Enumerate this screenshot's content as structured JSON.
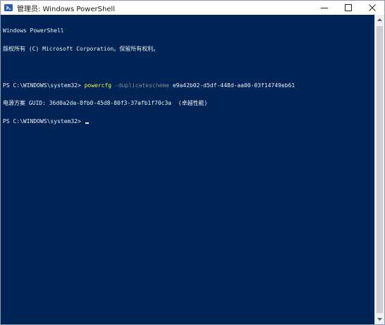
{
  "window": {
    "title": "管理员: Windows PowerShell",
    "icon": "powershell-icon",
    "controls": {
      "minimize": "minimize-icon",
      "maximize": "maximize-icon",
      "close": "close-icon"
    }
  },
  "console": {
    "banner_1": "Windows PowerShell",
    "banner_2": "版权所有 (C) Microsoft Corporation。保留所有权利。",
    "prompt_1": "PS C:\\WINDOWS\\system32> ",
    "command_name": "powercfg",
    "command_param": " -duplicatescheme",
    "command_arg": " e9a42b02-d5df-448d-aa00-03f14749eb61",
    "output_line": "电源方案 GUID: 36d0a2da-8fb0-45d8-80f3-37afb1f70c3a  (卓越性能)",
    "prompt_2": "PS C:\\WINDOWS\\system32> "
  },
  "colors": {
    "console_bg": "#012456",
    "console_text": "#eeedf0",
    "command": "#f5f543",
    "parameter": "#8a8a8a"
  }
}
